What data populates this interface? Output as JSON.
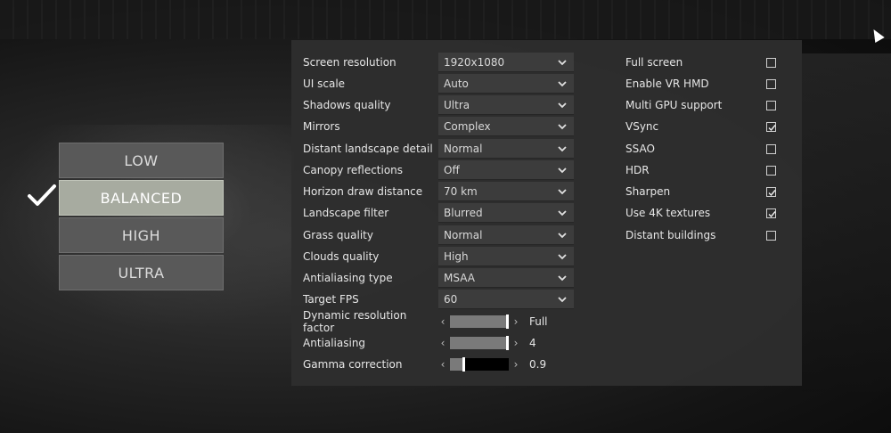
{
  "presets": [
    {
      "label": "LOW",
      "selected": false
    },
    {
      "label": "BALANCED",
      "selected": true
    },
    {
      "label": "HIGH",
      "selected": false
    },
    {
      "label": "ULTRA",
      "selected": false
    }
  ],
  "settings": {
    "dropdowns": [
      {
        "label": "Screen resolution",
        "value": "1920x1080"
      },
      {
        "label": "UI scale",
        "value": "Auto"
      },
      {
        "label": "Shadows quality",
        "value": "Ultra"
      },
      {
        "label": "Mirrors",
        "value": "Complex"
      },
      {
        "label": "Distant landscape detail",
        "value": "Normal"
      },
      {
        "label": "Canopy reflections",
        "value": "Off"
      },
      {
        "label": "Horizon draw distance",
        "value": "70 km"
      },
      {
        "label": "Landscape filter",
        "value": "Blurred"
      },
      {
        "label": "Grass quality",
        "value": "Normal"
      },
      {
        "label": "Clouds quality",
        "value": "High"
      },
      {
        "label": "Antialiasing type",
        "value": "MSAA"
      },
      {
        "label": "Target FPS",
        "value": "60"
      }
    ],
    "sliders": [
      {
        "label": "Dynamic resolution factor",
        "value": "Full",
        "level": 1.0
      },
      {
        "label": "Antialiasing",
        "value": "4",
        "level": 1.0
      },
      {
        "label": "Gamma correction",
        "value": "0.9",
        "level": 0.25
      }
    ],
    "checkboxes": [
      {
        "label": "Full screen",
        "checked": false
      },
      {
        "label": "Enable VR HMD",
        "checked": false
      },
      {
        "label": "Multi GPU support",
        "checked": false
      },
      {
        "label": "VSync",
        "checked": true
      },
      {
        "label": "SSAO",
        "checked": false
      },
      {
        "label": "HDR",
        "checked": false
      },
      {
        "label": "Sharpen",
        "checked": true
      },
      {
        "label": "Use 4K textures",
        "checked": true
      },
      {
        "label": "Distant buildings",
        "checked": false
      }
    ]
  },
  "icons": {
    "selected_preset": "checkmark-icon",
    "dropdown": "chevron-down-icon",
    "slider_left": "arrow-left-icon",
    "slider_right": "arrow-right-icon",
    "cursor": "mouse-cursor-icon"
  },
  "colors": {
    "panel_bg": "#2e2e2e",
    "preset_selected_bg": "#a7aba0",
    "preset_bg": "#595959"
  }
}
